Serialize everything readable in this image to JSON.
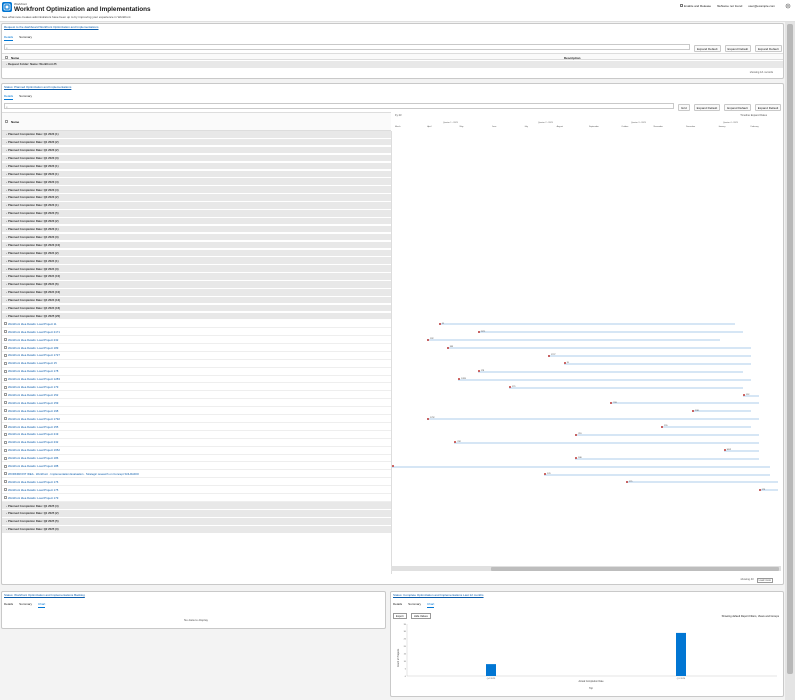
{
  "app": {
    "eyebrow": "Workfront",
    "title": "Workfront Optimization and Implementations",
    "subtitle": "See what new creates administrators have been up to by improving your experience in Workfront",
    "header_toggle_label": "Enable and Release",
    "header_info": "fileName not found",
    "header_user": "user@example.com"
  },
  "panel1": {
    "title": "Request to the dashboard Workfront Optimization and Implementations",
    "tabs": [
      {
        "label": "Details"
      },
      {
        "label": "Summary"
      }
    ],
    "search_placeholder": "Search",
    "toolbar": [
      {
        "label": "Expand Default"
      },
      {
        "label": "Expand Default"
      },
      {
        "label": "Expand Default"
      }
    ],
    "col_name": "Name",
    "col_desc": "Description",
    "rows": [
      {
        "label": "Request Folder: Name: Workfront #5"
      }
    ],
    "footer": "showing 1/1 records"
  },
  "panel2": {
    "title": "Status: Planned Optimization and Implementations",
    "tabs": [
      {
        "label": "Details"
      },
      {
        "label": "Summary"
      }
    ],
    "search_placeholder": "Search",
    "toolbar": [
      {
        "label": "Grid"
      },
      {
        "label": "Expand Default"
      },
      {
        "label": "Expand Default"
      },
      {
        "label": "Expand Default"
      }
    ],
    "col_name": "Name",
    "timeline_year": "Fy 23",
    "timeline_right": "Timeline Expand Dates",
    "timeline_quarters": [
      "Quarter 1 - 2023",
      "Quarter 2 - 2023",
      "Quarter 3 - 2023",
      "Quarter 4 - 2023"
    ],
    "timeline_months": [
      "March",
      "April",
      "May",
      "June",
      "July",
      "August",
      "September",
      "October",
      "November",
      "December",
      "January",
      "February"
    ],
    "footer": "showing 43",
    "footer_btn": "Load more",
    "rows": [
      {
        "type": "grp",
        "label": "Planned Completion Date: Q1 2023 (1)"
      },
      {
        "type": "grp",
        "label": "Planned Completion Date: Q1 2023 (2)"
      },
      {
        "type": "grp",
        "label": "Planned Completion Date: Q1 2023 (2)"
      },
      {
        "type": "grp",
        "label": "Planned Completion Date: Q1 2023 (3)"
      },
      {
        "type": "grp",
        "label": "Planned Completion Date: Q2 2023 (1)"
      },
      {
        "type": "grp",
        "label": "Planned Completion Date: Q2 2023 (1)"
      },
      {
        "type": "grp",
        "label": "Planned Completion Date: Q2 2023 (4)"
      },
      {
        "type": "grp",
        "label": "Planned Completion Date: Q2 2023 (4)"
      },
      {
        "type": "grp",
        "label": "Planned Completion Date: Q3 2023 (2)"
      },
      {
        "type": "grp",
        "label": "Planned Completion Date: Q3 2023 (1)"
      },
      {
        "type": "grp",
        "label": "Planned Completion Date: Q3 2023 (5)"
      },
      {
        "type": "grp",
        "label": "Planned Completion Date: Q3 2023 (2)"
      },
      {
        "type": "grp",
        "label": "Planned Completion Date: Q4 2023 (1)"
      },
      {
        "type": "grp",
        "label": "Planned Completion Date: Q4 2023 (3)"
      },
      {
        "type": "grp",
        "label": "Planned Completion Date: Q4 2023 (10)"
      },
      {
        "type": "grp",
        "label": "Planned Completion Date: Q1 2024 (2)"
      },
      {
        "type": "grp",
        "label": "Planned Completion Date: Q1 2024 (1)"
      },
      {
        "type": "grp",
        "label": "Planned Completion Date: Q2 2024 (3)"
      },
      {
        "type": "grp",
        "label": "Planned Completion Date: Q2 2024 (10)"
      },
      {
        "type": "grp",
        "label": "Planned Completion Date: Q3 2024 (6)"
      },
      {
        "type": "grp",
        "label": "Planned Completion Date: Q3 2024 (10)"
      },
      {
        "type": "grp",
        "label": "Planned Completion Date: Q4 2024 (12)"
      },
      {
        "type": "grp",
        "label": "Planned Completion Date: Q4 2024 (16)"
      },
      {
        "type": "grp",
        "label": "Planned Completion Date: Q1 2025 (20)"
      },
      {
        "type": "itm",
        "label": "Workfront Idea Details: Load Project 11"
      },
      {
        "type": "itm",
        "label": "Workfront Idea Details: Load Project 2171"
      },
      {
        "type": "itm",
        "label": "Workfront Idea Details: Load Project 232"
      },
      {
        "type": "itm",
        "label": "Workfront Idea Details: Load Project 189"
      },
      {
        "type": "itm",
        "label": "Workfront Idea Details: Load Project 1727"
      },
      {
        "type": "itm",
        "label": "Workfront Idea Details: Load Project 15"
      },
      {
        "type": "itm",
        "label": "Workfront Idea Details: Load Project 178"
      },
      {
        "type": "itm",
        "label": "Workfront Idea Details: Load Project 1283"
      },
      {
        "type": "itm",
        "label": "Workfront Idea Details: Load Project 179"
      },
      {
        "type": "itm",
        "label": "Workfront Idea Details: Load Project 152"
      },
      {
        "type": "itm",
        "label": "Workfront Idea Details: Load Project 159"
      },
      {
        "type": "itm",
        "label": "Workfront Idea Details: Load Project 198"
      },
      {
        "type": "itm",
        "label": "Workfront Idea Details: Load Project 1792"
      },
      {
        "type": "itm",
        "label": "Workfront Idea Details: Load Project 155"
      },
      {
        "type": "itm",
        "label": "Workfront Idea Details: Load Project 219"
      },
      {
        "type": "itm",
        "label": "Workfront Idea Details: Load Project 232"
      },
      {
        "type": "itm",
        "label": "Workfront Idea Details: Load Project 1652"
      },
      {
        "type": "itm",
        "label": "Workfront Idea Details: Load Project 186"
      },
      {
        "type": "itm",
        "label": "Workfront Idea Details: Load Project 188"
      },
      {
        "type": "itm",
        "label": "WORKFRONT IDEA · Workfront · Implementation Evaluation · Strategic research on Concept SOLRADIO"
      },
      {
        "type": "itm",
        "label": "Workfront Idea Details: Load Project 176"
      },
      {
        "type": "itm",
        "label": "Workfront Idea Details: Load Project 175"
      },
      {
        "type": "itm",
        "label": "Workfront Idea Details: Load Project 179"
      },
      {
        "type": "grp",
        "label": "Planned Completion Date: Q1 2025 (4)"
      },
      {
        "type": "grp",
        "label": "Planned Completion Date: Q1 2025 (2)"
      },
      {
        "type": "grp",
        "label": "Planned Completion Date: Q2 2025 (5)"
      },
      {
        "type": "grp",
        "label": "Planned Completion Date: Q2 2025 (3)"
      }
    ],
    "gantt": [
      {
        "row": 24,
        "start": 0.12,
        "end": 0.88,
        "label": "11"
      },
      {
        "row": 25,
        "start": 0.22,
        "end": 0.9,
        "label": "2171"
      },
      {
        "row": 26,
        "start": 0.09,
        "end": 0.84,
        "label": "232"
      },
      {
        "row": 27,
        "start": 0.14,
        "end": 0.92,
        "label": "189"
      },
      {
        "row": 28,
        "start": 0.4,
        "end": 0.92,
        "label": "1727"
      },
      {
        "row": 29,
        "start": 0.44,
        "end": 0.92,
        "label": "15"
      },
      {
        "row": 30,
        "start": 0.22,
        "end": 0.9,
        "label": "178"
      },
      {
        "row": 31,
        "start": 0.17,
        "end": 0.92,
        "label": "1283"
      },
      {
        "row": 32,
        "start": 0.3,
        "end": 0.9,
        "label": "179"
      },
      {
        "row": 33,
        "start": 0.9,
        "end": 0.94,
        "label": "152"
      },
      {
        "row": 34,
        "start": 0.56,
        "end": 0.94,
        "label": "159"
      },
      {
        "row": 35,
        "start": 0.77,
        "end": 0.92,
        "label": "198"
      },
      {
        "row": 36,
        "start": 0.09,
        "end": 0.94,
        "label": "1792"
      },
      {
        "row": 37,
        "start": 0.69,
        "end": 0.92,
        "label": "155"
      },
      {
        "row": 38,
        "start": 0.47,
        "end": 0.94,
        "label": "219"
      },
      {
        "row": 39,
        "start": 0.16,
        "end": 0.94,
        "label": "232"
      },
      {
        "row": 40,
        "start": 0.85,
        "end": 0.94,
        "label": "1652"
      },
      {
        "row": 41,
        "start": 0.47,
        "end": 0.94,
        "label": "186"
      },
      {
        "row": 42,
        "start": 0.0,
        "end": 0.97,
        "label": ""
      },
      {
        "row": 43,
        "start": 0.39,
        "end": 0.97,
        "label": "176"
      },
      {
        "row": 44,
        "start": 0.6,
        "end": 0.99,
        "label": "175"
      },
      {
        "row": 45,
        "start": 0.94,
        "end": 0.99,
        "label": "179"
      }
    ]
  },
  "panel3": {
    "title": "Status: Workfront Optimization and Implementations Backlog",
    "tabs": [
      {
        "label": "Details"
      },
      {
        "label": "Summary"
      },
      {
        "label": "Chart"
      }
    ],
    "empty": "No data to display"
  },
  "panel4": {
    "title": "Status: Complete Optimization and Implementations Last 12 months",
    "tabs": [
      {
        "label": "Details"
      },
      {
        "label": "Summary"
      },
      {
        "label": "Chart"
      }
    ],
    "btn_export": "Export",
    "btn_hide": "Hide Values",
    "chart_note": "Showing default Report Filters, Views and Groups"
  },
  "chart_data": {
    "type": "bar",
    "categories": [
      "Q4 2023",
      "Q1 2024"
    ],
    "values": [
      8,
      29
    ],
    "ylim": [
      0,
      35
    ],
    "xlabel": "Actual Completion Date",
    "ylabel": "Count of Projects",
    "legend": "Top",
    "bar_color": "#0176d3"
  }
}
